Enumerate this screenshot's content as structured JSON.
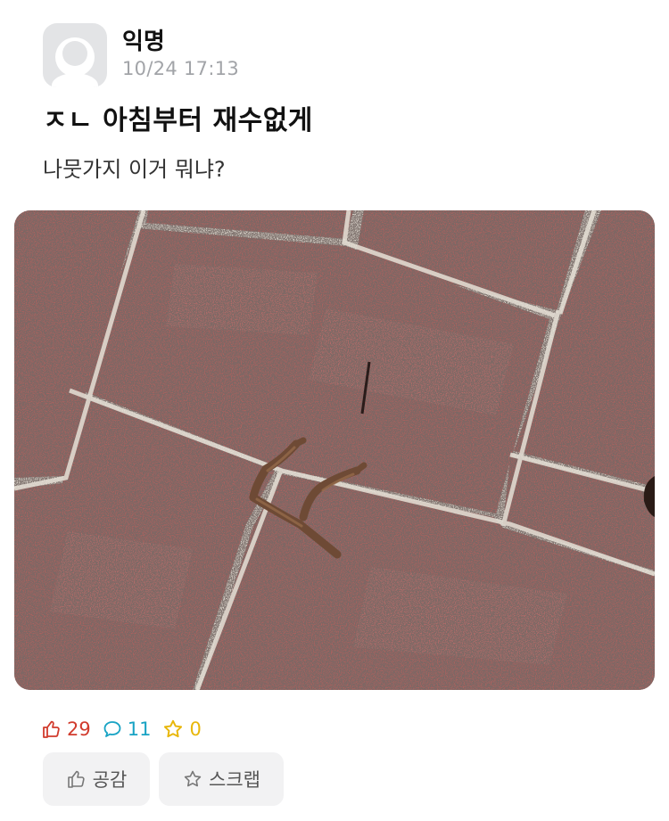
{
  "post": {
    "author": "익명",
    "time": "10/24 17:13",
    "title": "ㅈㄴ 아침부터 재수없게",
    "body": "나뭇가지 이거 뭐냐?",
    "image_alt": "brick pavement with twig shaped like a letter"
  },
  "stats": {
    "likes": "29",
    "comments": "11",
    "scraps": "0"
  },
  "actions": {
    "like_label": "공감",
    "scrap_label": "스크랩"
  },
  "colors": {
    "like": "#d13b2d",
    "comment": "#18a3c4",
    "scrap": "#e8b70a",
    "meta_gray": "#a2a4a8",
    "button_bg": "#f2f2f3"
  }
}
